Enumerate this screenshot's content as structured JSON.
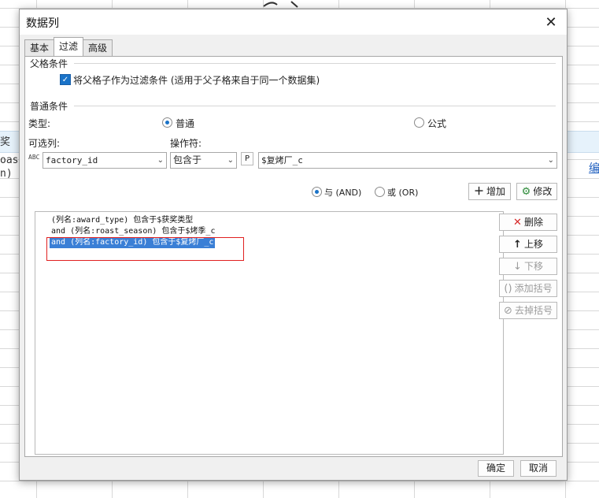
{
  "background": {
    "row_text_1": "奖",
    "row_text_2": "oast",
    "row_text_3": "n)",
    "link_text": "编"
  },
  "dialog": {
    "title": "数据列",
    "close_label": "✕",
    "tabs": [
      {
        "label": "基本"
      },
      {
        "label": "过滤"
      },
      {
        "label": "高级"
      }
    ],
    "parent_group": {
      "title": "父格条件",
      "checkbox_label": "将父格子作为过滤条件 (适用于父子格来自于同一个数据集)",
      "checked": true
    },
    "common_group": {
      "title": "普通条件",
      "type_label": "类型:",
      "type_option_normal": "普通",
      "type_option_formula": "公式",
      "selected_type": "普通",
      "column_label": "可选列:",
      "operator_label": "操作符:",
      "column_value": "factory_id",
      "column_icon_text": "ABC",
      "operator_value": "包含于",
      "param_badge": "P",
      "param_value": "$复烤厂_c",
      "and_label": "与 (AND)",
      "or_label": "或 (OR)",
      "selected_logic": "AND",
      "add_button": "增加",
      "modify_button": "修改"
    },
    "conditions": [
      "(列名:award_type) 包含于$获奖类型",
      "and (列名:roast_season) 包含于$烤季_c",
      "and (列名:factory_id) 包含于$复烤厂_c"
    ],
    "selected_condition_index": 2,
    "side_buttons": {
      "delete": "删除",
      "move_up": "上移",
      "move_down": "下移",
      "add_bracket": "添加括号",
      "remove_bracket": "去掉括号"
    },
    "footer": {
      "ok": "确定",
      "cancel": "取消"
    },
    "colors": {
      "accent": "#1a73c8",
      "selection": "#3a7fd6",
      "highlight_box": "#e02020",
      "delete_icon": "#d62828",
      "modify_icon": "#2e8b3a"
    }
  }
}
